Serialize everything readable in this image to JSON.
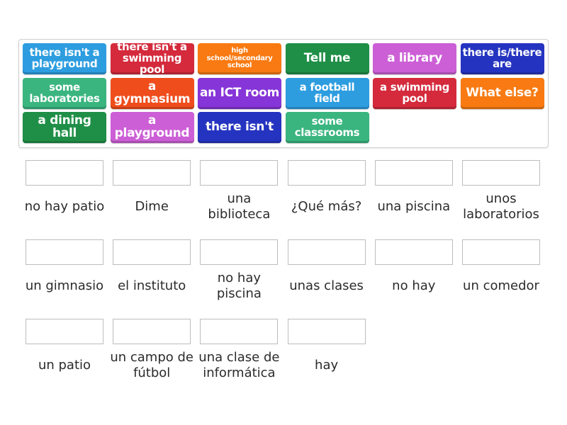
{
  "word_bank": {
    "tiles": [
      {
        "text": "there isn't a playground",
        "color": "#2d9de0"
      },
      {
        "text": "there isn't a swimming pool",
        "color": "#d42a3c"
      },
      {
        "text": "high school/secondary school",
        "color": "#f97a12"
      },
      {
        "text": "Tell me",
        "color": "#1f8f47"
      },
      {
        "text": "a library",
        "color": "#cc5fd6"
      },
      {
        "text": "there is/there are",
        "color": "#2534c0"
      },
      {
        "text": "some laboratories",
        "color": "#3ab57f"
      },
      {
        "text": "a gymnasium",
        "color": "#ef4d1c"
      },
      {
        "text": "an ICT room",
        "color": "#8635d8"
      },
      {
        "text": "a football field",
        "color": "#2d9de0"
      },
      {
        "text": "a swimming pool",
        "color": "#d42a3c"
      },
      {
        "text": "What else?",
        "color": "#f97a12"
      },
      {
        "text": "a dining hall",
        "color": "#1f8f47"
      },
      {
        "text": "a playground",
        "color": "#cc5fd6"
      },
      {
        "text": "there isn't",
        "color": "#2534c0"
      },
      {
        "text": "some classrooms",
        "color": "#3ab57f"
      }
    ]
  },
  "targets": [
    {
      "label": "no hay patio",
      "answer": ""
    },
    {
      "label": "Dime",
      "answer": ""
    },
    {
      "label": "una biblioteca",
      "answer": ""
    },
    {
      "label": "¿Qué más?",
      "answer": ""
    },
    {
      "label": "una piscina",
      "answer": ""
    },
    {
      "label": "unos laboratorios",
      "answer": ""
    },
    {
      "label": "un gimnasio",
      "answer": ""
    },
    {
      "label": "el instituto",
      "answer": ""
    },
    {
      "label": "no hay piscina",
      "answer": ""
    },
    {
      "label": "unas clases",
      "answer": ""
    },
    {
      "label": "no hay",
      "answer": ""
    },
    {
      "label": "un comedor",
      "answer": ""
    },
    {
      "label": "un patio",
      "answer": ""
    },
    {
      "label": "un campo de fútbol",
      "answer": ""
    },
    {
      "label": "una clase de informática",
      "answer": ""
    },
    {
      "label": "hay",
      "answer": ""
    }
  ]
}
